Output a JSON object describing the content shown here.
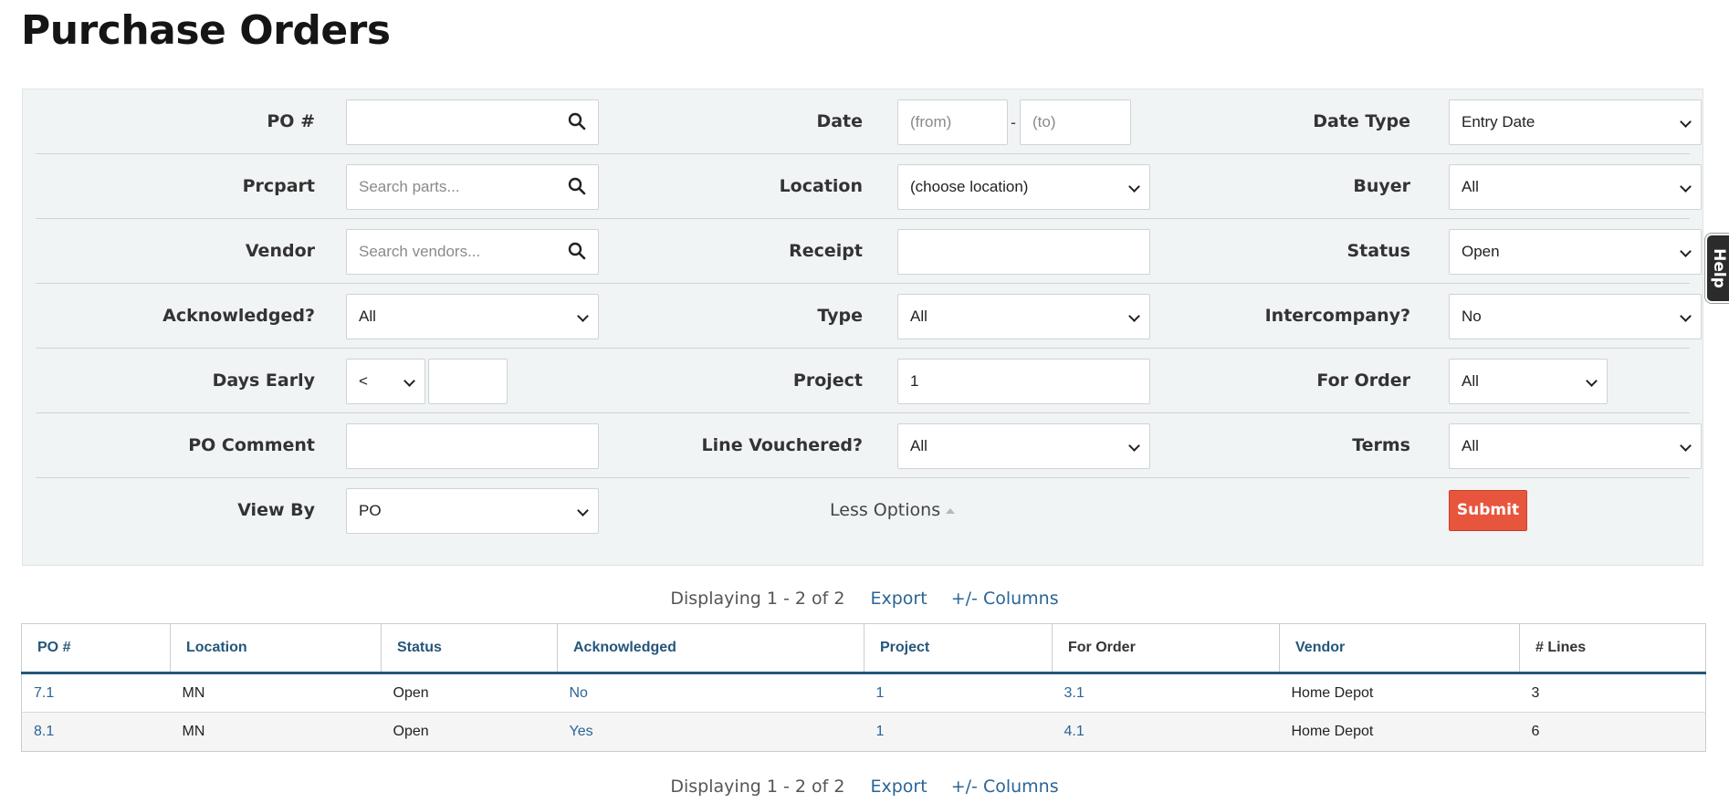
{
  "page": {
    "title": "Purchase Orders"
  },
  "help": {
    "label": "Help"
  },
  "filters": {
    "po_number": {
      "label": "PO #",
      "value": ""
    },
    "date": {
      "label": "Date",
      "from_placeholder": "(from)",
      "to_placeholder": "(to)",
      "separator": "-"
    },
    "date_type": {
      "label": "Date Type",
      "value": "Entry Date"
    },
    "prcpart": {
      "label": "Prcpart",
      "placeholder": "Search parts..."
    },
    "location": {
      "label": "Location",
      "value": "(choose location)"
    },
    "buyer": {
      "label": "Buyer",
      "value": "All"
    },
    "vendor": {
      "label": "Vendor",
      "placeholder": "Search vendors..."
    },
    "receipt": {
      "label": "Receipt",
      "value": ""
    },
    "status": {
      "label": "Status",
      "value": "Open"
    },
    "acknowledged": {
      "label": "Acknowledged?",
      "value": "All"
    },
    "type": {
      "label": "Type",
      "value": "All"
    },
    "intercompany": {
      "label": "Intercompany?",
      "value": "No"
    },
    "days_early": {
      "label": "Days Early",
      "operator": "<",
      "value": ""
    },
    "project": {
      "label": "Project",
      "value": "1"
    },
    "for_order": {
      "label": "For Order",
      "value": "All"
    },
    "po_comment": {
      "label": "PO Comment",
      "value": ""
    },
    "line_vouchered": {
      "label": "Line Vouchered?",
      "value": "All"
    },
    "terms": {
      "label": "Terms",
      "value": "All"
    },
    "view_by": {
      "label": "View By",
      "value": "PO"
    },
    "less_options": "Less Options",
    "submit": "Submit"
  },
  "pager": {
    "text": "Displaying 1 - 2 of 2",
    "export": "Export",
    "columns": "+/- Columns"
  },
  "table": {
    "headers": [
      "PO #",
      "Location",
      "Status",
      "Acknowledged",
      "Project",
      "For Order",
      "Vendor",
      "# Lines"
    ],
    "rows": [
      [
        "7.1",
        "MN",
        "Open",
        "No",
        "1",
        "3.1",
        "Home Depot",
        "3"
      ],
      [
        "8.1",
        "MN",
        "Open",
        "Yes",
        "1",
        "4.1",
        "Home Depot",
        "6"
      ]
    ]
  },
  "colors": {
    "link": "#2a6496",
    "header_rule": "#24567a",
    "submit": "#e8553d",
    "panel": "#f1f4f5"
  }
}
